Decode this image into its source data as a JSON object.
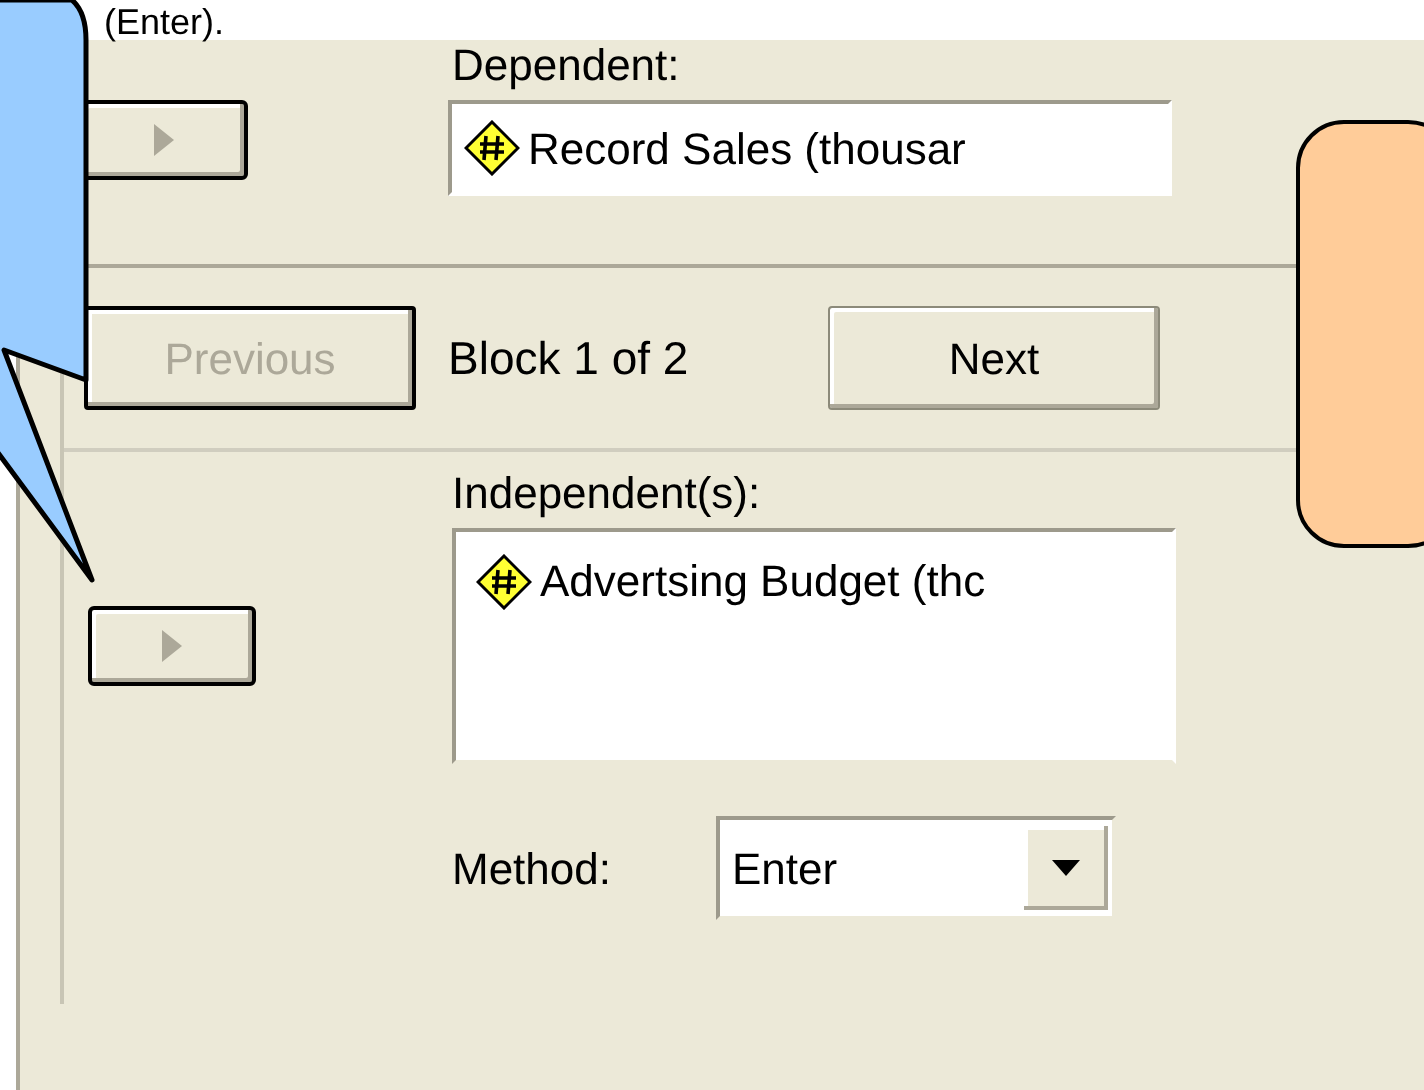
{
  "slide_text": "(Enter).",
  "dependent": {
    "label": "Dependent:",
    "value": "Record Sales (thousar"
  },
  "block": {
    "previous": {
      "label": "Previous",
      "disabled": true
    },
    "status": "Block 1 of 2",
    "next": {
      "label": "Next",
      "disabled": false
    }
  },
  "independents": {
    "label": "Independent(s):",
    "items": [
      "Advertsing Budget (thc"
    ]
  },
  "method": {
    "label": "Method:",
    "value": "Enter"
  }
}
